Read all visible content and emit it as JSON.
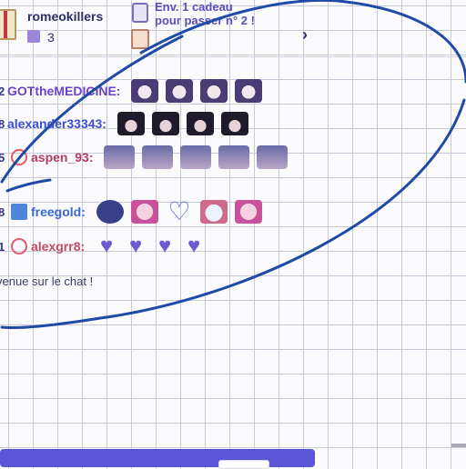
{
  "header": {
    "top_username": "romeokillers",
    "gift_count": "3",
    "gift_line_1": "Env. 1 cadeau",
    "gift_line_2": "pour passer n° 2 !",
    "chevron": "›"
  },
  "chat": {
    "rows": [
      {
        "num": "2",
        "username": "GOTtheMEDICINE:",
        "color": "#6a43c8"
      },
      {
        "num": "8",
        "username": "alexander33343:",
        "color": "#3a4ccf"
      },
      {
        "num": "5",
        "username": "aspen_93:",
        "color": "#b33b66"
      },
      {
        "num": "8",
        "username": "freegold:",
        "color": "#3b66d6"
      },
      {
        "num": "1",
        "username": "alexgrr8:",
        "color": "#c04b66"
      }
    ],
    "welcome_text": "venue sur le chat !"
  },
  "icons": {
    "gift": "gift-icon",
    "crown": "crown-icon",
    "ring": "ring-badge-icon",
    "heart": "heart-icon"
  },
  "colors": {
    "accent": "#5a54d6",
    "ink": "#1f4aa5"
  }
}
